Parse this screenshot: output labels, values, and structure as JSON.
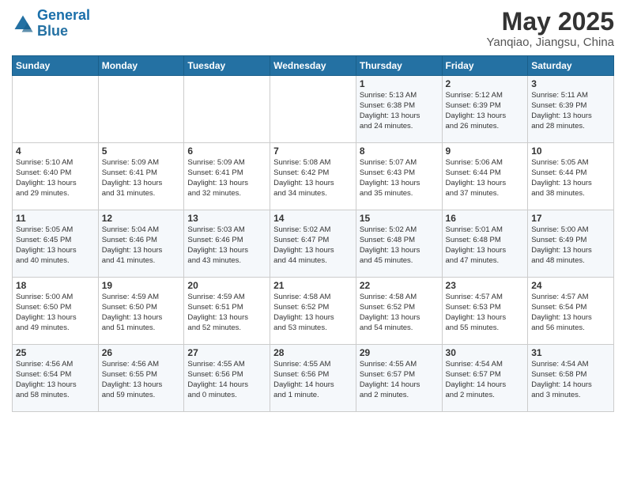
{
  "header": {
    "logo_line1": "General",
    "logo_line2": "Blue",
    "title": "May 2025",
    "subtitle": "Yanqiao, Jiangsu, China"
  },
  "days_of_week": [
    "Sunday",
    "Monday",
    "Tuesday",
    "Wednesday",
    "Thursday",
    "Friday",
    "Saturday"
  ],
  "weeks": [
    [
      {
        "day": "",
        "info": ""
      },
      {
        "day": "",
        "info": ""
      },
      {
        "day": "",
        "info": ""
      },
      {
        "day": "",
        "info": ""
      },
      {
        "day": "1",
        "info": "Sunrise: 5:13 AM\nSunset: 6:38 PM\nDaylight: 13 hours\nand 24 minutes."
      },
      {
        "day": "2",
        "info": "Sunrise: 5:12 AM\nSunset: 6:39 PM\nDaylight: 13 hours\nand 26 minutes."
      },
      {
        "day": "3",
        "info": "Sunrise: 5:11 AM\nSunset: 6:39 PM\nDaylight: 13 hours\nand 28 minutes."
      }
    ],
    [
      {
        "day": "4",
        "info": "Sunrise: 5:10 AM\nSunset: 6:40 PM\nDaylight: 13 hours\nand 29 minutes."
      },
      {
        "day": "5",
        "info": "Sunrise: 5:09 AM\nSunset: 6:41 PM\nDaylight: 13 hours\nand 31 minutes."
      },
      {
        "day": "6",
        "info": "Sunrise: 5:09 AM\nSunset: 6:41 PM\nDaylight: 13 hours\nand 32 minutes."
      },
      {
        "day": "7",
        "info": "Sunrise: 5:08 AM\nSunset: 6:42 PM\nDaylight: 13 hours\nand 34 minutes."
      },
      {
        "day": "8",
        "info": "Sunrise: 5:07 AM\nSunset: 6:43 PM\nDaylight: 13 hours\nand 35 minutes."
      },
      {
        "day": "9",
        "info": "Sunrise: 5:06 AM\nSunset: 6:44 PM\nDaylight: 13 hours\nand 37 minutes."
      },
      {
        "day": "10",
        "info": "Sunrise: 5:05 AM\nSunset: 6:44 PM\nDaylight: 13 hours\nand 38 minutes."
      }
    ],
    [
      {
        "day": "11",
        "info": "Sunrise: 5:05 AM\nSunset: 6:45 PM\nDaylight: 13 hours\nand 40 minutes."
      },
      {
        "day": "12",
        "info": "Sunrise: 5:04 AM\nSunset: 6:46 PM\nDaylight: 13 hours\nand 41 minutes."
      },
      {
        "day": "13",
        "info": "Sunrise: 5:03 AM\nSunset: 6:46 PM\nDaylight: 13 hours\nand 43 minutes."
      },
      {
        "day": "14",
        "info": "Sunrise: 5:02 AM\nSunset: 6:47 PM\nDaylight: 13 hours\nand 44 minutes."
      },
      {
        "day": "15",
        "info": "Sunrise: 5:02 AM\nSunset: 6:48 PM\nDaylight: 13 hours\nand 45 minutes."
      },
      {
        "day": "16",
        "info": "Sunrise: 5:01 AM\nSunset: 6:48 PM\nDaylight: 13 hours\nand 47 minutes."
      },
      {
        "day": "17",
        "info": "Sunrise: 5:00 AM\nSunset: 6:49 PM\nDaylight: 13 hours\nand 48 minutes."
      }
    ],
    [
      {
        "day": "18",
        "info": "Sunrise: 5:00 AM\nSunset: 6:50 PM\nDaylight: 13 hours\nand 49 minutes."
      },
      {
        "day": "19",
        "info": "Sunrise: 4:59 AM\nSunset: 6:50 PM\nDaylight: 13 hours\nand 51 minutes."
      },
      {
        "day": "20",
        "info": "Sunrise: 4:59 AM\nSunset: 6:51 PM\nDaylight: 13 hours\nand 52 minutes."
      },
      {
        "day": "21",
        "info": "Sunrise: 4:58 AM\nSunset: 6:52 PM\nDaylight: 13 hours\nand 53 minutes."
      },
      {
        "day": "22",
        "info": "Sunrise: 4:58 AM\nSunset: 6:52 PM\nDaylight: 13 hours\nand 54 minutes."
      },
      {
        "day": "23",
        "info": "Sunrise: 4:57 AM\nSunset: 6:53 PM\nDaylight: 13 hours\nand 55 minutes."
      },
      {
        "day": "24",
        "info": "Sunrise: 4:57 AM\nSunset: 6:54 PM\nDaylight: 13 hours\nand 56 minutes."
      }
    ],
    [
      {
        "day": "25",
        "info": "Sunrise: 4:56 AM\nSunset: 6:54 PM\nDaylight: 13 hours\nand 58 minutes."
      },
      {
        "day": "26",
        "info": "Sunrise: 4:56 AM\nSunset: 6:55 PM\nDaylight: 13 hours\nand 59 minutes."
      },
      {
        "day": "27",
        "info": "Sunrise: 4:55 AM\nSunset: 6:56 PM\nDaylight: 14 hours\nand 0 minutes."
      },
      {
        "day": "28",
        "info": "Sunrise: 4:55 AM\nSunset: 6:56 PM\nDaylight: 14 hours\nand 1 minute."
      },
      {
        "day": "29",
        "info": "Sunrise: 4:55 AM\nSunset: 6:57 PM\nDaylight: 14 hours\nand 2 minutes."
      },
      {
        "day": "30",
        "info": "Sunrise: 4:54 AM\nSunset: 6:57 PM\nDaylight: 14 hours\nand 2 minutes."
      },
      {
        "day": "31",
        "info": "Sunrise: 4:54 AM\nSunset: 6:58 PM\nDaylight: 14 hours\nand 3 minutes."
      }
    ]
  ]
}
